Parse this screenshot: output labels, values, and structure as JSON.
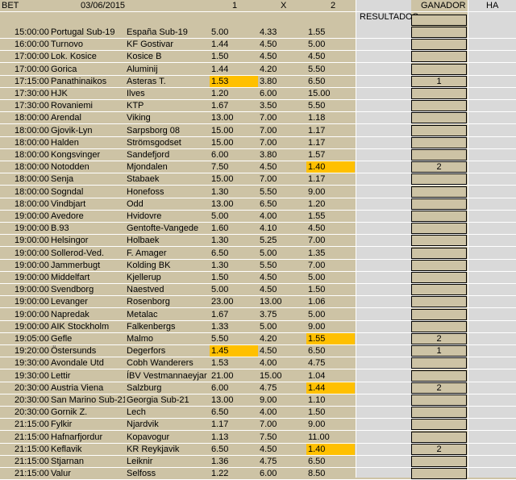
{
  "header": {
    "bet": "BET",
    "date": "03/06/2015",
    "col1": "1",
    "colx": "X",
    "col2": "2",
    "resultados": "RESULTADOS",
    "ganador": "GANADOR",
    "ha": "HA"
  },
  "highlight_color": "#ffc000",
  "matches": [
    {
      "time": "15:00:00",
      "home": "Portugal Sub-19",
      "away": "España Sub-19",
      "o1": "5.00",
      "ox": "4.33",
      "o2": "1.55",
      "hl": "",
      "winner": ""
    },
    {
      "time": "16:00:00",
      "home": "Turnovo",
      "away": "KF Gostivar",
      "o1": "1.44",
      "ox": "4.50",
      "o2": "5.00",
      "hl": "",
      "winner": ""
    },
    {
      "time": "17:00:00",
      "home": "Lok. Kosice",
      "away": "Kosice B",
      "o1": "1.50",
      "ox": "4.50",
      "o2": "4.50",
      "hl": "",
      "winner": ""
    },
    {
      "time": "17:00:00",
      "home": "Gorica",
      "away": "Aluminij",
      "o1": "1.44",
      "ox": "4.20",
      "o2": "5.50",
      "hl": "",
      "winner": ""
    },
    {
      "time": "17:15:00",
      "home": "Panathinaikos",
      "away": "Asteras T.",
      "o1": "1.53",
      "ox": "3.80",
      "o2": "6.50",
      "hl": "1",
      "winner": "1"
    },
    {
      "time": "17:30:00",
      "home": "HJK",
      "away": "Ilves",
      "o1": "1.20",
      "ox": "6.00",
      "o2": "15.00",
      "hl": "",
      "winner": ""
    },
    {
      "time": "17:30:00",
      "home": "Rovaniemi",
      "away": "KTP",
      "o1": "1.67",
      "ox": "3.50",
      "o2": "5.50",
      "hl": "",
      "winner": ""
    },
    {
      "time": "18:00:00",
      "home": "Arendal",
      "away": "Viking",
      "o1": "13.00",
      "ox": "7.00",
      "o2": "1.18",
      "hl": "",
      "winner": ""
    },
    {
      "time": "18:00:00",
      "home": "Gjovik-Lyn",
      "away": "Sarpsborg 08",
      "o1": "15.00",
      "ox": "7.00",
      "o2": "1.17",
      "hl": "",
      "winner": ""
    },
    {
      "time": "18:00:00",
      "home": "Halden",
      "away": "Strömsgodset",
      "o1": "15.00",
      "ox": "7.00",
      "o2": "1.17",
      "hl": "",
      "winner": ""
    },
    {
      "time": "18:00:00",
      "home": "Kongsvinger",
      "away": "Sandefjord",
      "o1": "6.00",
      "ox": "3.80",
      "o2": "1.57",
      "hl": "",
      "winner": ""
    },
    {
      "time": "18:00:00",
      "home": "Notodden",
      "away": "Mjondalen",
      "o1": "7.50",
      "ox": "4.50",
      "o2": "1.40",
      "hl": "2",
      "winner": "2"
    },
    {
      "time": "18:00:00",
      "home": "Senja",
      "away": "Stabaek",
      "o1": "15.00",
      "ox": "7.00",
      "o2": "1.17",
      "hl": "",
      "winner": ""
    },
    {
      "time": "18:00:00",
      "home": "Sogndal",
      "away": "Honefoss",
      "o1": "1.30",
      "ox": "5.50",
      "o2": "9.00",
      "hl": "",
      "winner": ""
    },
    {
      "time": "18:00:00",
      "home": "Vindbjart",
      "away": "Odd",
      "o1": "13.00",
      "ox": "6.50",
      "o2": "1.20",
      "hl": "",
      "winner": ""
    },
    {
      "time": "19:00:00",
      "home": "Avedore",
      "away": "Hvidovre",
      "o1": "5.00",
      "ox": "4.00",
      "o2": "1.55",
      "hl": "",
      "winner": ""
    },
    {
      "time": "19:00:00",
      "home": "B.93",
      "away": "Gentofte-Vangede",
      "o1": "1.60",
      "ox": "4.10",
      "o2": "4.50",
      "hl": "",
      "winner": ""
    },
    {
      "time": "19:00:00",
      "home": "Helsingor",
      "away": "Holbaek",
      "o1": "1.30",
      "ox": "5.25",
      "o2": "7.00",
      "hl": "",
      "winner": ""
    },
    {
      "time": "19:00:00",
      "home": "Sollerod-Ved.",
      "away": "F. Amager",
      "o1": "6.50",
      "ox": "5.00",
      "o2": "1.35",
      "hl": "",
      "winner": ""
    },
    {
      "time": "19:00:00",
      "home": "Jammerbugt",
      "away": "Kolding BK",
      "o1": "1.30",
      "ox": "5.50",
      "o2": "7.00",
      "hl": "",
      "winner": ""
    },
    {
      "time": "19:00:00",
      "home": "Middelfart",
      "away": "Kjellerup",
      "o1": "1.50",
      "ox": "4.50",
      "o2": "5.00",
      "hl": "",
      "winner": ""
    },
    {
      "time": "19:00:00",
      "home": "Svendborg",
      "away": "Naestved",
      "o1": "5.00",
      "ox": "4.50",
      "o2": "1.50",
      "hl": "",
      "winner": ""
    },
    {
      "time": "19:00:00",
      "home": "Levanger",
      "away": "Rosenborg",
      "o1": "23.00",
      "ox": "13.00",
      "o2": "1.06",
      "hl": "",
      "winner": ""
    },
    {
      "time": "19:00:00",
      "home": "Napredak",
      "away": "Metalac",
      "o1": "1.67",
      "ox": "3.75",
      "o2": "5.00",
      "hl": "",
      "winner": ""
    },
    {
      "time": "19:00:00",
      "home": "AIK Stockholm",
      "away": "Falkenbergs",
      "o1": "1.33",
      "ox": "5.00",
      "o2": "9.00",
      "hl": "",
      "winner": ""
    },
    {
      "time": "19:05:00",
      "home": "Gefle",
      "away": "Malmo",
      "o1": "5.50",
      "ox": "4.20",
      "o2": "1.55",
      "hl": "2",
      "winner": "2"
    },
    {
      "time": "19:20:00",
      "home": "Östersunds",
      "away": "Degerfors",
      "o1": "1.45",
      "ox": "4.50",
      "o2": "6.50",
      "hl": "1",
      "winner": "1"
    },
    {
      "time": "19:30:00",
      "home": "Avondale Utd",
      "away": "Cobh Wanderers",
      "o1": "1.53",
      "ox": "4.00",
      "o2": "4.75",
      "hl": "",
      "winner": ""
    },
    {
      "time": "19:30:00",
      "home": "Lettir",
      "away": "ÍBV Vestmannaeyjar",
      "o1": "21.00",
      "ox": "15.00",
      "o2": "1.04",
      "hl": "",
      "winner": ""
    },
    {
      "time": "20:30:00",
      "home": "Austria Viena",
      "away": "Salzburg",
      "o1": "6.00",
      "ox": "4.75",
      "o2": "1.44",
      "hl": "2",
      "winner": "2"
    },
    {
      "time": "20:30:00",
      "home": "San Marino Sub-21",
      "away": "Georgia Sub-21",
      "o1": "13.00",
      "ox": "9.00",
      "o2": "1.10",
      "hl": "",
      "winner": ""
    },
    {
      "time": "20:30:00",
      "home": "Gornik Z.",
      "away": "Lech",
      "o1": "6.50",
      "ox": "4.00",
      "o2": "1.50",
      "hl": "",
      "winner": ""
    },
    {
      "time": "21:15:00",
      "home": "Fylkir",
      "away": "Njardvik",
      "o1": "1.17",
      "ox": "7.00",
      "o2": "9.00",
      "hl": "",
      "winner": ""
    },
    {
      "time": "21:15:00",
      "home": "Hafnarfjordur",
      "away": "Kopavogur",
      "o1": "1.13",
      "ox": "7.50",
      "o2": "11.00",
      "hl": "",
      "winner": ""
    },
    {
      "time": "21:15:00",
      "home": "Keflavik",
      "away": "KR Reykjavik",
      "o1": "6.50",
      "ox": "4.50",
      "o2": "1.40",
      "hl": "2",
      "winner": "2"
    },
    {
      "time": "21:15:00",
      "home": "Stjarnan",
      "away": "Leiknir",
      "o1": "1.36",
      "ox": "4.75",
      "o2": "6.50",
      "hl": "",
      "winner": ""
    },
    {
      "time": "21:15:00",
      "home": "Valur",
      "away": "Selfoss",
      "o1": "1.22",
      "ox": "6.00",
      "o2": "8.50",
      "hl": "",
      "winner": ""
    }
  ]
}
